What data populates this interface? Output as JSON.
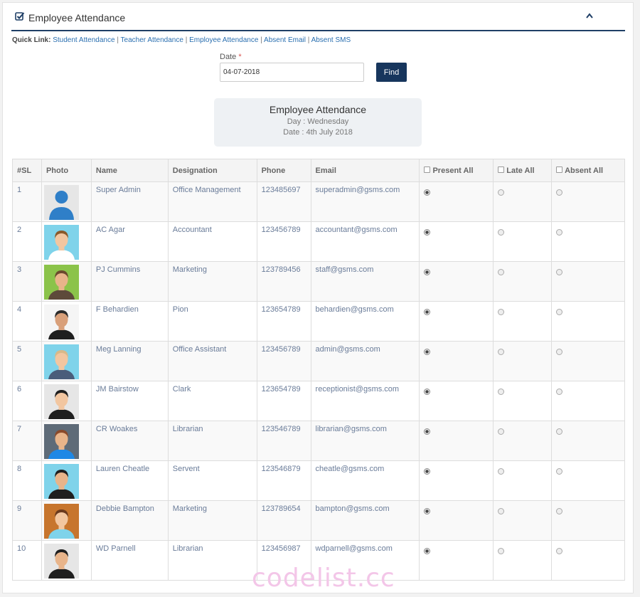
{
  "header": {
    "title": "Employee Attendance"
  },
  "quick_links": {
    "label": "Quick Link:",
    "links": [
      "Student Attendance",
      "Teacher Attendance",
      "Employee Attendance",
      "Absent Email",
      "Absent SMS"
    ]
  },
  "form": {
    "date_label": "Date",
    "required_mark": "*",
    "date_value": "04-07-2018",
    "find_label": "Find"
  },
  "info": {
    "title": "Employee Attendance",
    "day": "Day : Wednesday",
    "date": "Date : 4th July 2018"
  },
  "table": {
    "headers": [
      "#SL",
      "Photo",
      "Name",
      "Designation",
      "Phone",
      "Email",
      "Present All",
      "Late All",
      "Absent All"
    ],
    "rows": [
      {
        "sl": "1",
        "name": "Super Admin",
        "designation": "Office Management",
        "phone": "123485697",
        "email": "superadmin@gsms.com",
        "status": "present"
      },
      {
        "sl": "2",
        "name": "AC Agar",
        "designation": "Accountant",
        "phone": "123456789",
        "email": "accountant@gsms.com",
        "status": "present"
      },
      {
        "sl": "3",
        "name": "PJ Cummins",
        "designation": "Marketing",
        "phone": "123789456",
        "email": "staff@gsms.com",
        "status": "present"
      },
      {
        "sl": "4",
        "name": "F Behardien",
        "designation": "Pion",
        "phone": "123654789",
        "email": "behardien@gsms.com",
        "status": "present"
      },
      {
        "sl": "5",
        "name": "Meg Lanning",
        "designation": "Office Assistant",
        "phone": "123456789",
        "email": "admin@gsms.com",
        "status": "present"
      },
      {
        "sl": "6",
        "name": "JM Bairstow",
        "designation": "Clark",
        "phone": "123654789",
        "email": "receptionist@gsms.com",
        "status": "present"
      },
      {
        "sl": "7",
        "name": "CR Woakes",
        "designation": "Librarian",
        "phone": "123546789",
        "email": "librarian@gsms.com",
        "status": "present"
      },
      {
        "sl": "8",
        "name": "Lauren Cheatle",
        "designation": "Servent",
        "phone": "123546879",
        "email": "cheatle@gsms.com",
        "status": "present"
      },
      {
        "sl": "9",
        "name": "Debbie Bampton",
        "designation": "Marketing",
        "phone": "123789654",
        "email": "bampton@gsms.com",
        "status": "present"
      },
      {
        "sl": "10",
        "name": "WD Parnell",
        "designation": "Librarian",
        "phone": "123456987",
        "email": "wdparnell@gsms.com",
        "status": "present"
      }
    ]
  },
  "avatars": [
    {
      "bg": "#e6e6e6",
      "skin": "#2f7fc8",
      "hair": "#2f7fc8",
      "shirt": "#2f7fc8",
      "generic": true
    },
    {
      "bg": "#7fd3ea",
      "skin": "#f2c6a0",
      "hair": "#8a5a2b",
      "shirt": "#ffffff"
    },
    {
      "bg": "#8bc34a",
      "skin": "#e8b48a",
      "hair": "#6b4a2e",
      "shirt": "#5d4a3a"
    },
    {
      "bg": "#f5f5f5",
      "skin": "#d9a07a",
      "hair": "#2b2b2b",
      "shirt": "#1f1f1f"
    },
    {
      "bg": "#7fd3ea",
      "skin": "#f2c6a0",
      "hair": "#d7b98a",
      "shirt": "#4a5d7a"
    },
    {
      "bg": "#e6e6e6",
      "skin": "#f2c6a0",
      "hair": "#1f1f1f",
      "shirt": "#1f1f1f"
    },
    {
      "bg": "#5e6b78",
      "skin": "#e8b48a",
      "hair": "#8a4a2b",
      "shirt": "#1e88e5"
    },
    {
      "bg": "#7fd3ea",
      "skin": "#e8b48a",
      "hair": "#1f1f1f",
      "shirt": "#1f1f1f"
    },
    {
      "bg": "#c7752d",
      "skin": "#f2c6a0",
      "hair": "#6b3a1e",
      "shirt": "#7fd3ea"
    },
    {
      "bg": "#e6e6e6",
      "skin": "#e8b48a",
      "hair": "#1f1f1f",
      "shirt": "#1f1f1f"
    }
  ],
  "watermark": "codelist.cc",
  "colors": {
    "accent": "#17365d",
    "link": "#2a6fb0",
    "required": "#d9534f"
  }
}
